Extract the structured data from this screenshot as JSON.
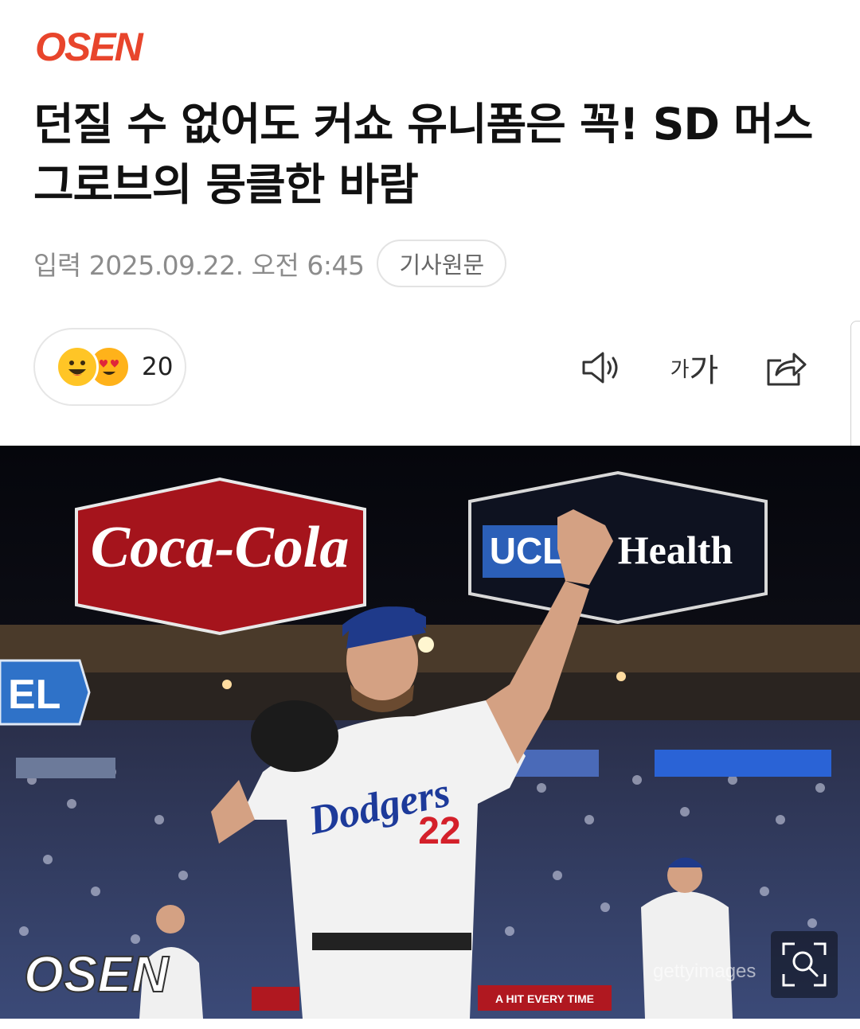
{
  "brand": {
    "logo_text": "OSEN",
    "accent": "#e8452c"
  },
  "article": {
    "title": "던질 수 없어도 커쇼 유니폼은 꼭! SD 머스그로브의 뭉클한 바람",
    "date": "입력 2025.09.22. 오전 6:45",
    "original_button": "기사원문"
  },
  "reactions": {
    "emojis": [
      "grinning-face",
      "heart-eyes-face"
    ],
    "count": "20"
  },
  "toolbar": {
    "speaker_icon": "speaker-icon",
    "font_size_small": "가",
    "font_size_big": "가",
    "share_icon": "share-icon"
  },
  "photo": {
    "sign_left": "Coca-Cola",
    "sign_right_a": "UCL",
    "sign_right_b": "Health",
    "sign_edge": "EL",
    "jersey_team": "Dodgers",
    "jersey_number": "22",
    "watermark_logo": "OSEN",
    "watermark_credit": "gettyimages",
    "banner_text": "A HIT EVERY TIME",
    "zoom_icon": "zoom-search-icon"
  }
}
